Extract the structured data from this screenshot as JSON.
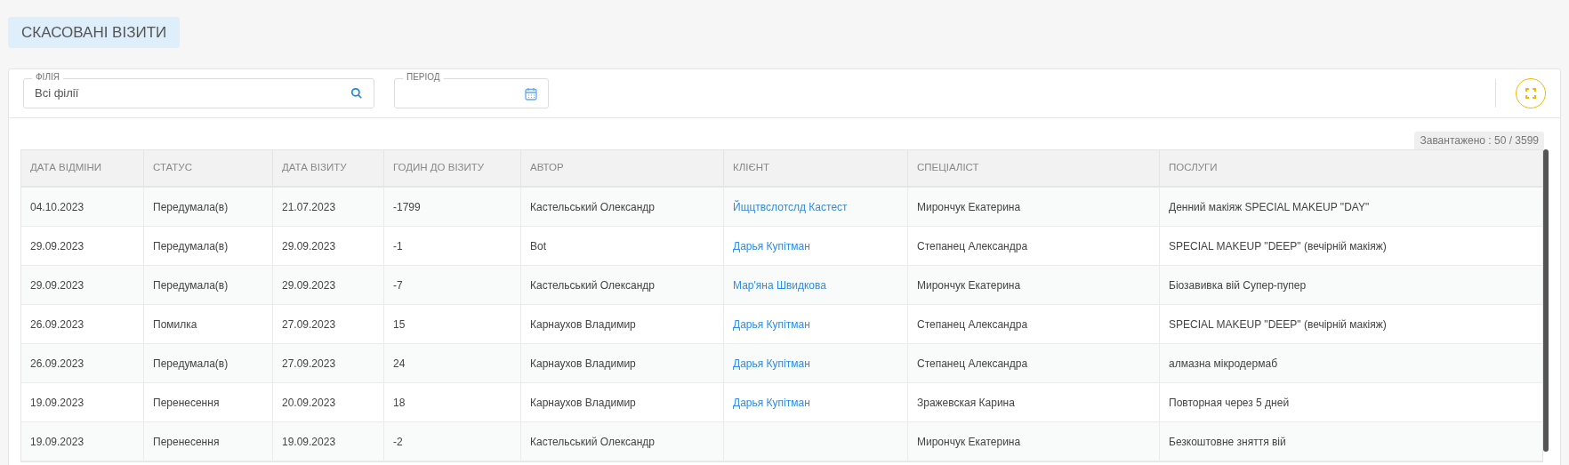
{
  "page_title": "СКАСОВАНІ ВІЗИТИ",
  "filters": [
    {
      "kind": "search",
      "label": "ФІЛІЯ",
      "value": "Всі філії"
    },
    {
      "kind": "date",
      "label": "ПЕРІОД"
    }
  ],
  "loaded_count": "Завантажено : 50 / 3599",
  "table": {
    "columns": [
      "ДАТА ВІДМІНИ",
      "СТАТУС",
      "ДАТА ВІЗИТУ",
      "ГОДИН ДО ВІЗИТУ",
      "АВТОР",
      "КЛІЄНТ",
      "СПЕЦІАЛІСТ",
      "ПОСЛУГИ"
    ],
    "rows": [
      {
        "cancel_date": "04.10.2023",
        "status": "Передумала(в)",
        "visit_date": "21.07.2023",
        "hours_to_visit": "-1799",
        "author": "Кастельський Олександр",
        "client": "Йщцтвслотслд Кастест",
        "specialist": "Мирончук Екатерина",
        "services": "Денний макіяж SPECIAL MAKEUP \"DAY\""
      },
      {
        "cancel_date": "29.09.2023",
        "status": "Передумала(в)",
        "visit_date": "29.09.2023",
        "hours_to_visit": "-1",
        "author": "Bot",
        "client": "Дарья Купітман",
        "specialist": "Степанец Александра",
        "services": "SPECIAL MAKEUP \"DEEP\" (вечірній макіяж)"
      },
      {
        "cancel_date": "29.09.2023",
        "status": "Передумала(в)",
        "visit_date": "29.09.2023",
        "hours_to_visit": "-7",
        "author": "Кастельський Олександр",
        "client": "Мар'яна Швидкова",
        "specialist": "Мирончук Екатерина",
        "services": "Біозавивка вій Супер-пупер"
      },
      {
        "cancel_date": "26.09.2023",
        "status": "Помилка",
        "visit_date": "27.09.2023",
        "hours_to_visit": "15",
        "author": "Карнаухов Владимир",
        "client": "Дарья Купітман",
        "specialist": "Степанец Александра",
        "services": "SPECIAL MAKEUP \"DEEP\" (вечірній макіяж)"
      },
      {
        "cancel_date": "26.09.2023",
        "status": "Передумала(в)",
        "visit_date": "27.09.2023",
        "hours_to_visit": "24",
        "author": "Карнаухов Владимир",
        "client": "Дарья Купітман",
        "specialist": "Степанец Александра",
        "services": "алмазна мікродермаб"
      },
      {
        "cancel_date": "19.09.2023",
        "status": "Перенесення",
        "visit_date": "20.09.2023",
        "hours_to_visit": "18",
        "author": "Карнаухов Владимир",
        "client": "Дарья Купітман",
        "specialist": "Зражевская Карина",
        "services": "Повторная через 5 дней"
      },
      {
        "cancel_date": "19.09.2023",
        "status": "Перенесення",
        "visit_date": "19.09.2023",
        "hours_to_visit": "-2",
        "author": "Кастельський Олександр",
        "specialist": "Мирончук Екатерина",
        "services": "Безкоштовне зняття вій"
      }
    ]
  }
}
